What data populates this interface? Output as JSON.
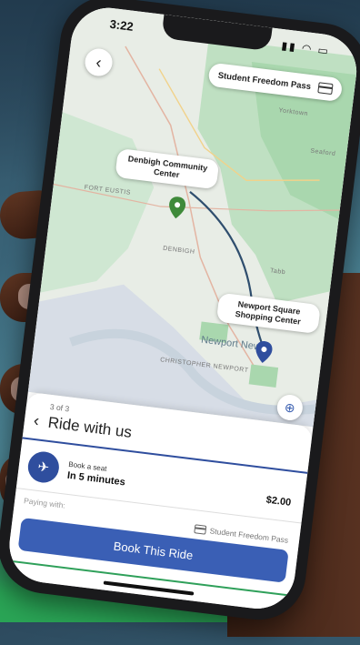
{
  "status_bar": {
    "time": "3:22",
    "icons": "▮▮ ◠ ▭"
  },
  "map": {
    "pass_chip_label": "Student Freedom Pass",
    "origin_label": "Denbigh Community Center",
    "destination_label": "Newport Square Shopping Center",
    "place_labels": [
      "FORT EUSTIS",
      "DENBIGH",
      "CHRISTOPHER NEWPORT",
      "Seaford",
      "Tabb",
      "Yorktown"
    ],
    "city_label": "Newport News",
    "colors": {
      "route": "#2f4e6e",
      "origin_pin": "#3f8a3a",
      "destination_pin": "#2f4e9e"
    }
  },
  "sheet": {
    "step": "3 of 3",
    "title": "Ride with us",
    "option_small": "Book a seat",
    "option_big": "In 5 minutes",
    "price": "$2.00",
    "paying_label": "Paying with:",
    "paying_method": "Student Freedom Pass",
    "book_button": "Book This Ride"
  }
}
